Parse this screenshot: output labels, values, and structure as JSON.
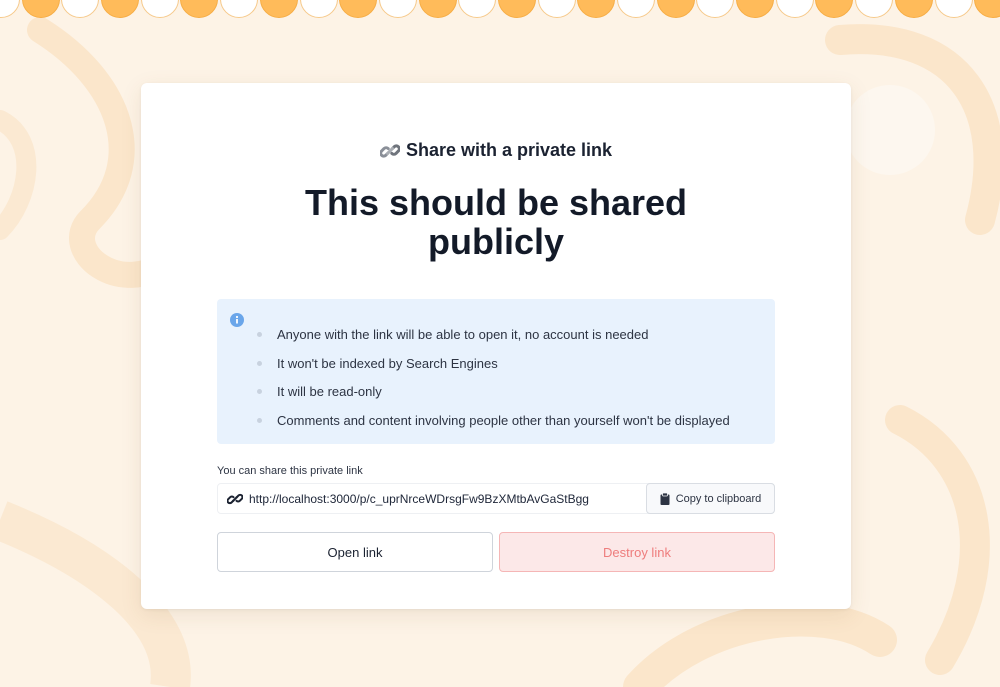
{
  "dialog": {
    "kicker": "Share with a private link",
    "title": "This should be shared publicly",
    "info_items": [
      "Anyone with the link will be able to open it, no account is needed",
      "It won't be indexed by Search Engines",
      "It will be read-only",
      "Comments and content involving people other than yourself won't be displayed"
    ],
    "share_label": "You can share this private link",
    "link_url": "http://localhost:3000/p/c_uprNrceWDrsgFw9BzXMtbAvGaStBgg",
    "copy_label": "Copy to clipboard",
    "open_label": "Open link",
    "destroy_label": "Destroy link"
  },
  "icons": {
    "kicker": "link-chain-icon",
    "info": "info-icon",
    "url": "link-icon",
    "copy": "clipboard-icon"
  },
  "colors": {
    "background": "#fdf3e6",
    "scallop_orange": "#ffbb5a",
    "info_bg": "#e8f2fd",
    "destroy_bg": "#fce8e8",
    "destroy_text": "#ee7d7d"
  }
}
